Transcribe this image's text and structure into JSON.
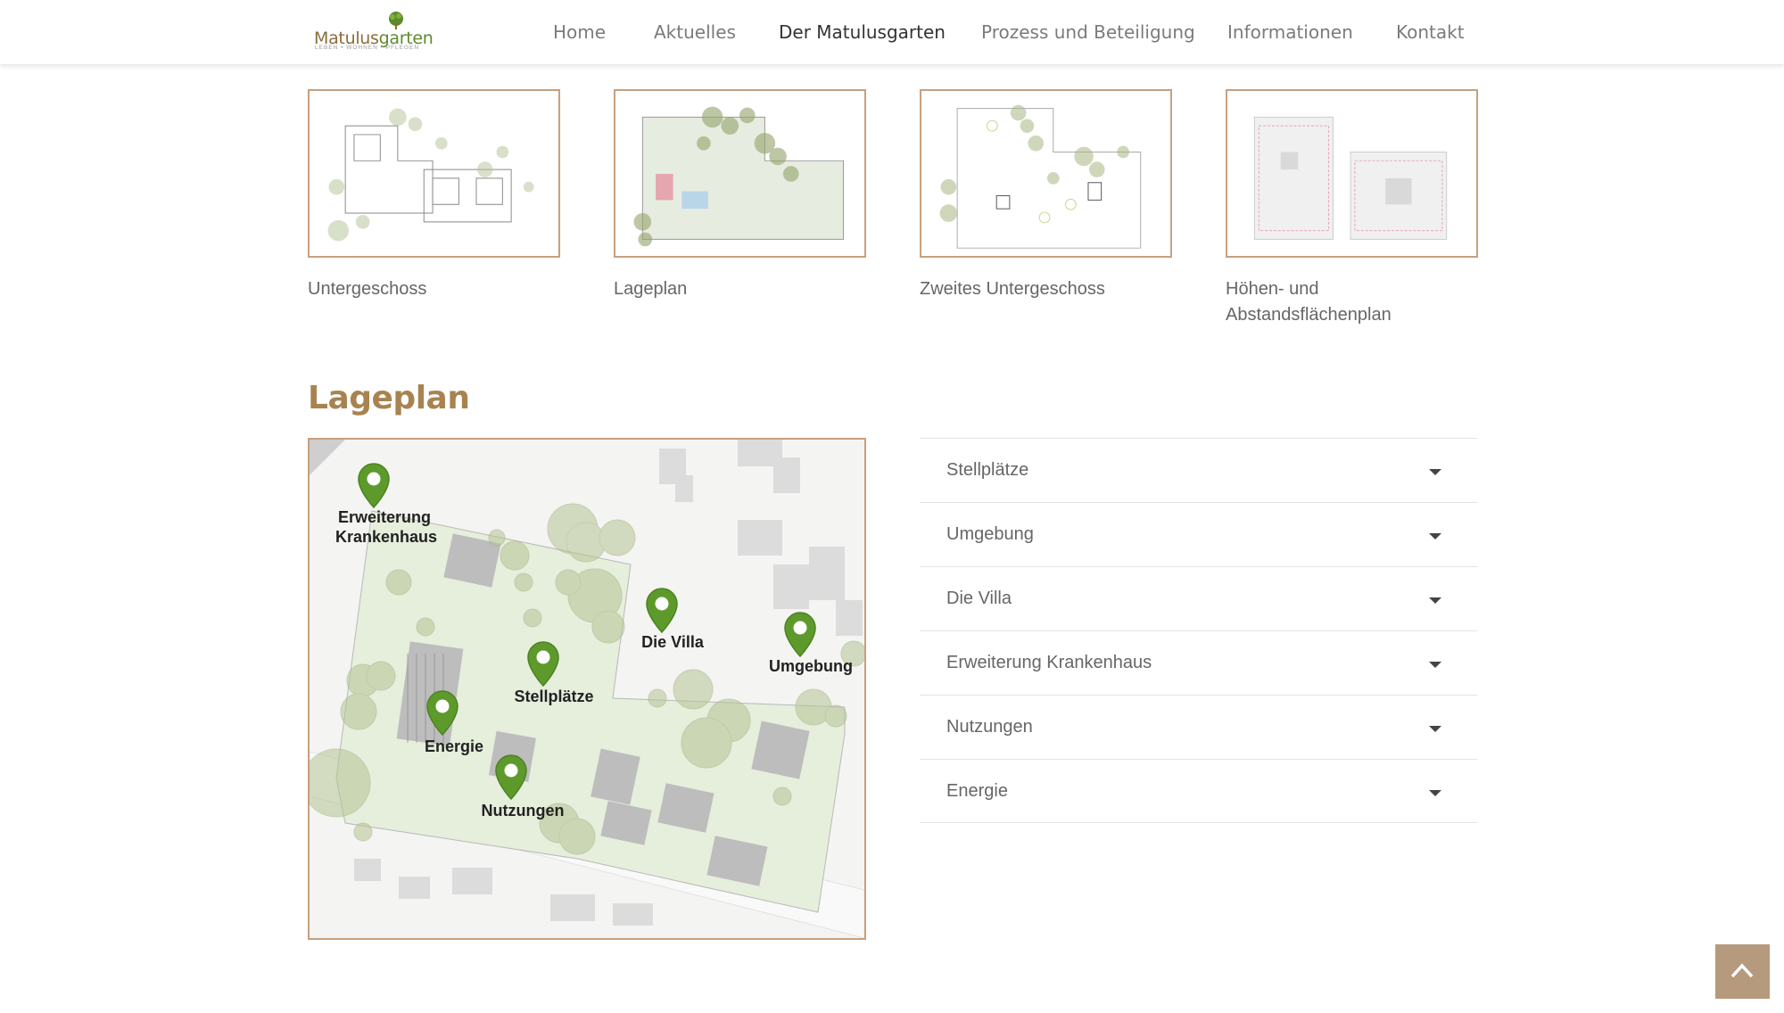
{
  "header": {
    "logo": {
      "name_part1": "Matulus",
      "name_part2": "garten",
      "tagline": "LEBEN • WOHNEN • PFLEGEN",
      "icon": "tree-icon"
    },
    "nav": [
      {
        "label": "Home"
      },
      {
        "label": "Aktuelles"
      },
      {
        "label": "Der Matulusgarten",
        "active": true
      },
      {
        "label": "Prozess und Beteiligung"
      },
      {
        "label": "Informationen"
      },
      {
        "label": "Kontakt"
      }
    ]
  },
  "gallery": [
    {
      "caption": "Untergeschoss"
    },
    {
      "caption": "Lageplan"
    },
    {
      "caption": "Zweites Untergeschoss"
    },
    {
      "caption": "Höhen- und Abstandsflächenplan"
    }
  ],
  "lageplan": {
    "title": "Lageplan",
    "map_pins": [
      {
        "label": "Erweiterung Krankenhaus",
        "icon": "map-pin-icon"
      },
      {
        "label": "Die Villa",
        "icon": "map-pin-icon"
      },
      {
        "label": "Umgebung",
        "icon": "map-pin-icon"
      },
      {
        "label": "Stellplätze",
        "icon": "map-pin-icon"
      },
      {
        "label": "Energie",
        "icon": "map-pin-icon"
      },
      {
        "label": "Nutzungen",
        "icon": "map-pin-icon"
      }
    ],
    "accordion": [
      {
        "label": "Stellplätze",
        "icon": "caret-down-icon"
      },
      {
        "label": "Umgebung",
        "icon": "caret-down-icon"
      },
      {
        "label": "Die Villa",
        "icon": "caret-down-icon"
      },
      {
        "label": "Erweiterung Krankenhaus",
        "icon": "caret-down-icon"
      },
      {
        "label": "Nutzungen",
        "icon": "caret-down-icon"
      },
      {
        "label": "Energie",
        "icon": "caret-down-icon"
      }
    ]
  },
  "back_to_top": {
    "icon": "chevron-up-icon"
  },
  "colors": {
    "accent_brown": "#a88350",
    "frame_border": "#c8a07e",
    "pin_green": "#5e9a2b",
    "back_to_top_bg": "#b59a7e"
  }
}
